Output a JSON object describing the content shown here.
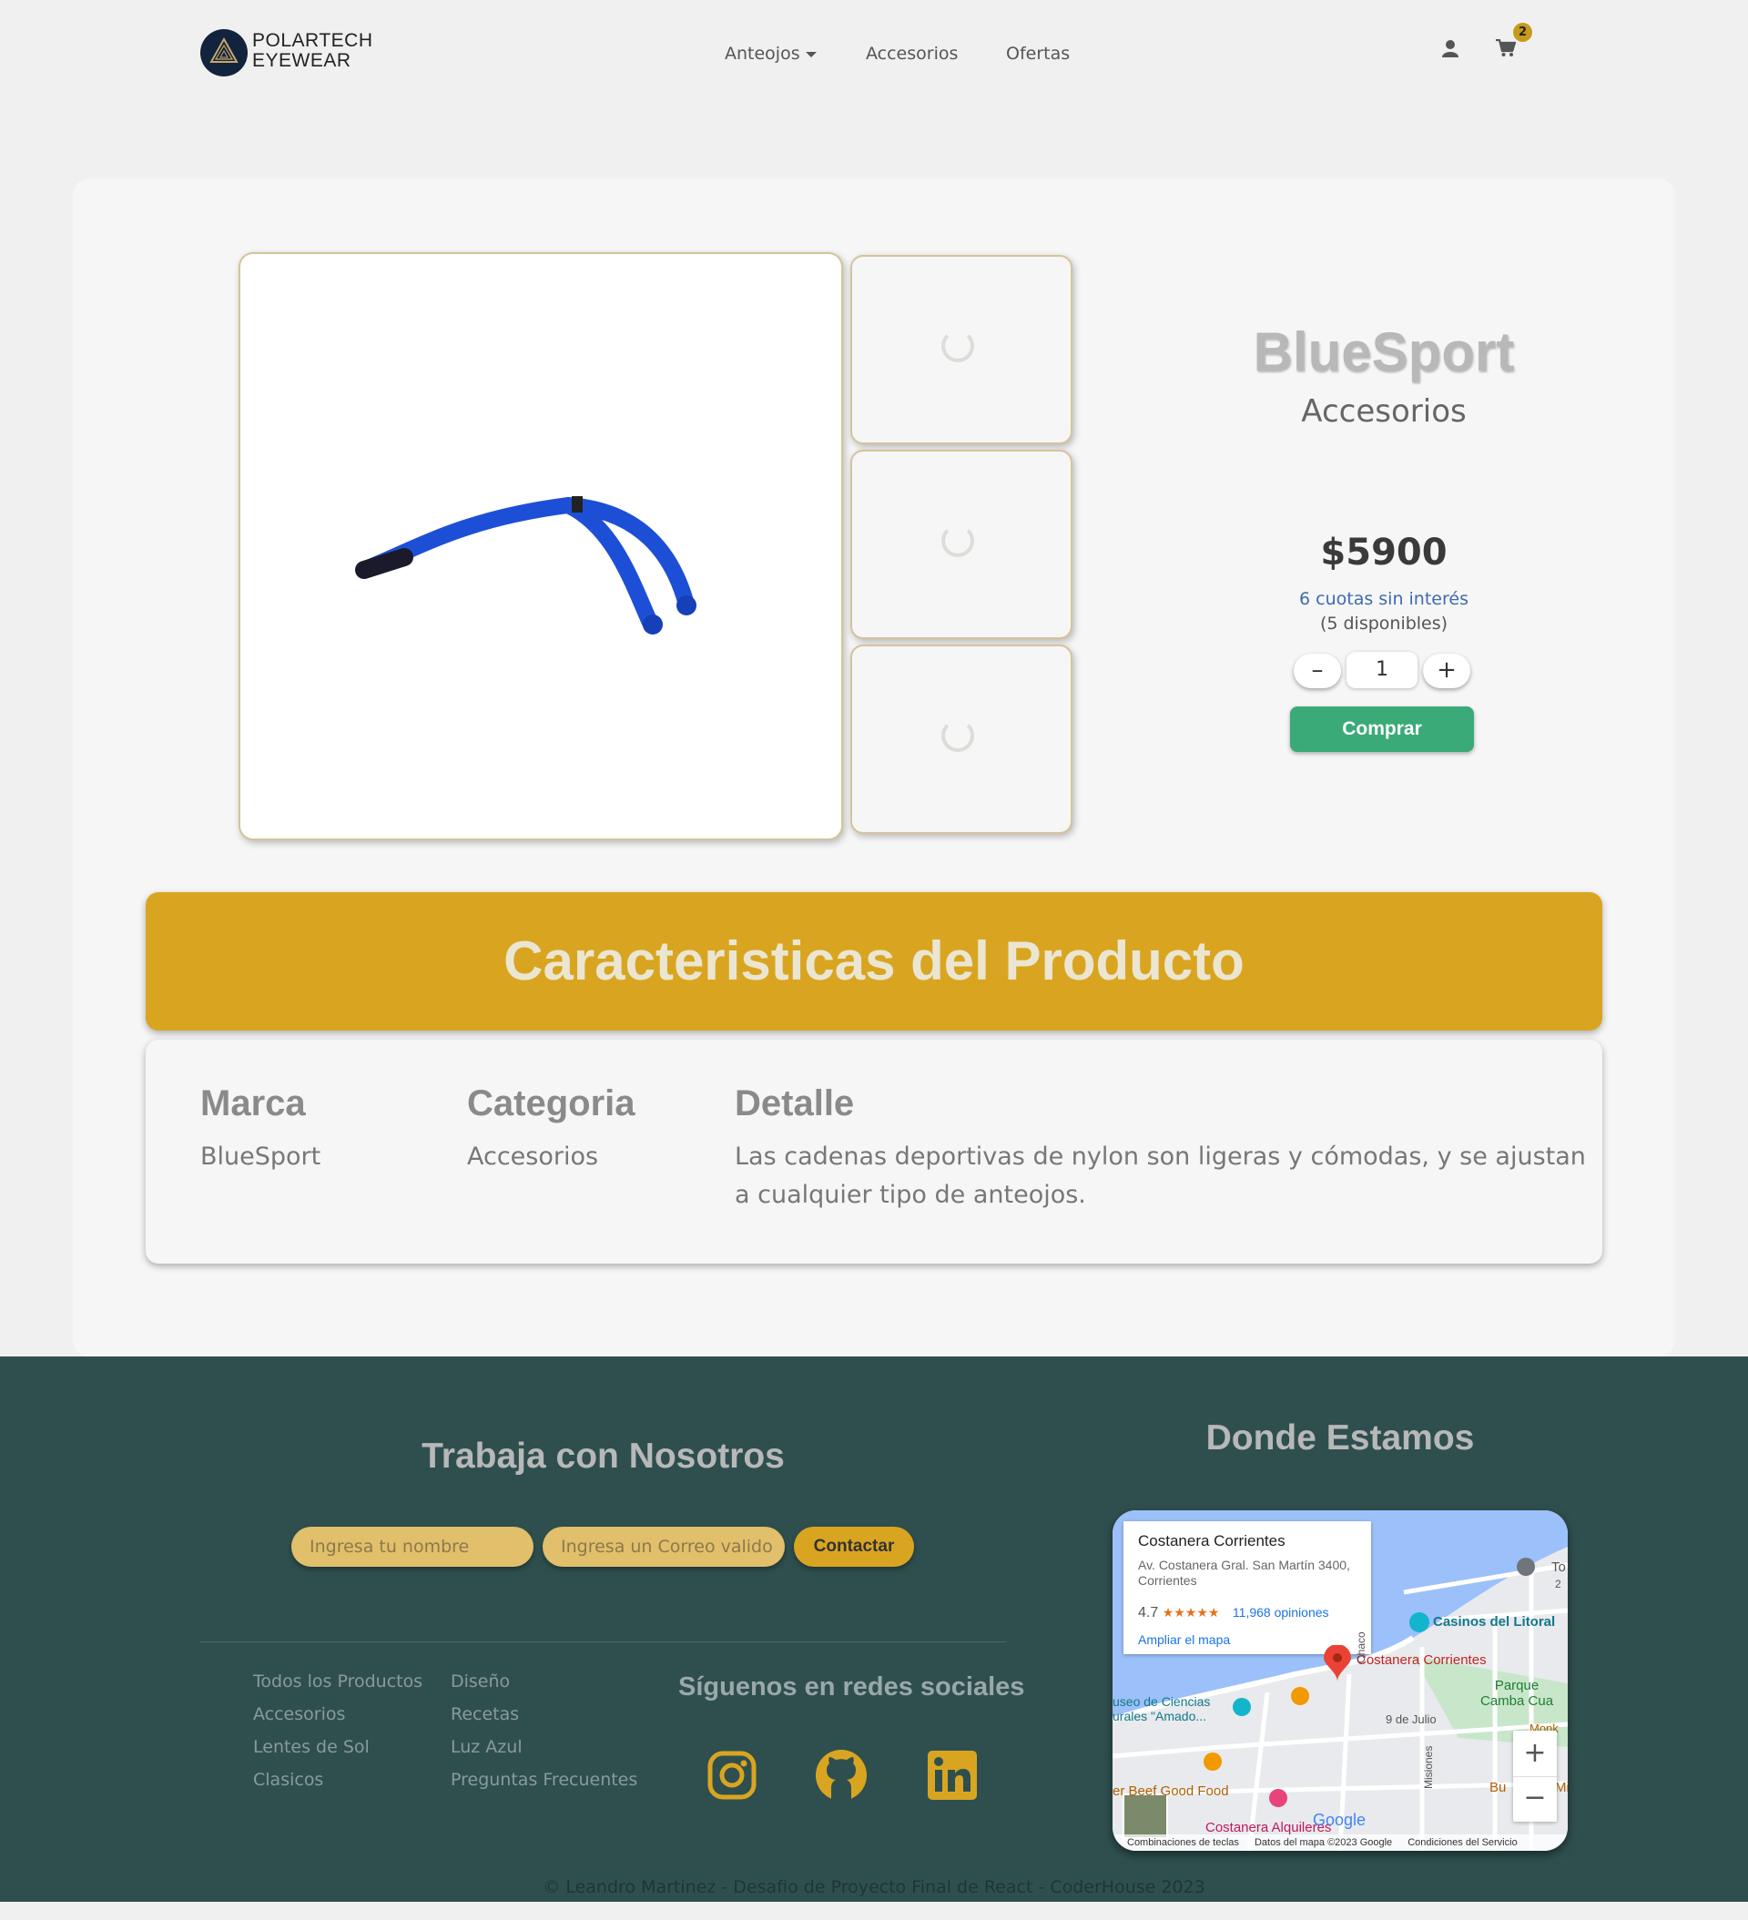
{
  "header": {
    "brand_line1": "POLARTECH",
    "brand_line2": "EYEWEAR",
    "nav": [
      {
        "label": "Anteojos"
      },
      {
        "label": "Accesorios"
      },
      {
        "label": "Ofertas"
      }
    ],
    "cart_count": "2"
  },
  "product": {
    "title": "BlueSport",
    "category": "Accesorios",
    "price": "$5900",
    "installments": "6 cuotas sin interés",
    "stock": "(5 disponibles)",
    "qty_minus": "–",
    "qty_value": "1",
    "qty_plus": "+",
    "buy_label": "Comprar"
  },
  "features": {
    "banner": "Caracteristicas del Producto",
    "brand_heading": "Marca",
    "brand_value": "BlueSport",
    "category_heading": "Categoria",
    "category_value": "Accesorios",
    "detail_heading": "Detalle",
    "detail_line1": "Las cadenas deportivas de nylon son ligeras y cómodas, y se ajustan",
    "detail_line2": "a cualquier tipo de anteojos."
  },
  "footer": {
    "work_title": "Trabaja con Nosotros",
    "name_placeholder": "Ingresa tu nombre",
    "email_placeholder": "Ingresa un Correo valido",
    "contact_label": "Contactar",
    "links_col1": [
      "Todos los Productos",
      "Accesorios",
      "Lentes de Sol",
      "Clasicos"
    ],
    "links_col2": [
      "Diseño",
      "Recetas",
      "Luz Azul",
      "Preguntas Frecuentes"
    ],
    "social_title": "Síguenos en redes sociales",
    "social_icons": [
      "instagram-icon",
      "github-icon",
      "linkedin-icon"
    ],
    "location_title": "Donde Estamos",
    "copyright": "© Leandro Martinez - Desafio de Proyecto Final de React - CoderHouse 2023"
  },
  "map": {
    "place_name": "Costanera Corrientes",
    "address_line1": "Av. Costanera Gral. San Martín 3400,",
    "address_line2": "Corrientes",
    "rating": "4.7",
    "stars": "★★★★★",
    "reviews": "11,968 opiniones",
    "expand": "Ampliar el mapa",
    "label_casinos": "Casinos del Litoral",
    "label_costanera": "Costanera Corrientes",
    "label_parque1": "Parque",
    "label_parque2": "Camba Cua",
    "label_museo1": "useo de Ciencias",
    "label_museo2": "urales \"Amado...",
    "label_9julio": "9 de Julio",
    "label_chaco": "Chaco",
    "label_misiones": "Misiones",
    "label_food": "er Beef Good Food",
    "label_alquileres": "Costanera Alquileres",
    "label_to": "To",
    "label_to2": "2",
    "label_monk": "Monk",
    "label_bu": "Bu",
    "label_mi": "Mi",
    "google": "Google",
    "zoom_in": "+",
    "zoom_out": "−",
    "attr1": "Combinaciones de teclas",
    "attr2": "Datos del mapa ©2023 Google",
    "attr3": "Condiciones del Servicio"
  },
  "colors": {
    "accent_gold": "#d9a521",
    "footer_bg": "#2f4f4f",
    "buy_green": "#3aaa78"
  }
}
